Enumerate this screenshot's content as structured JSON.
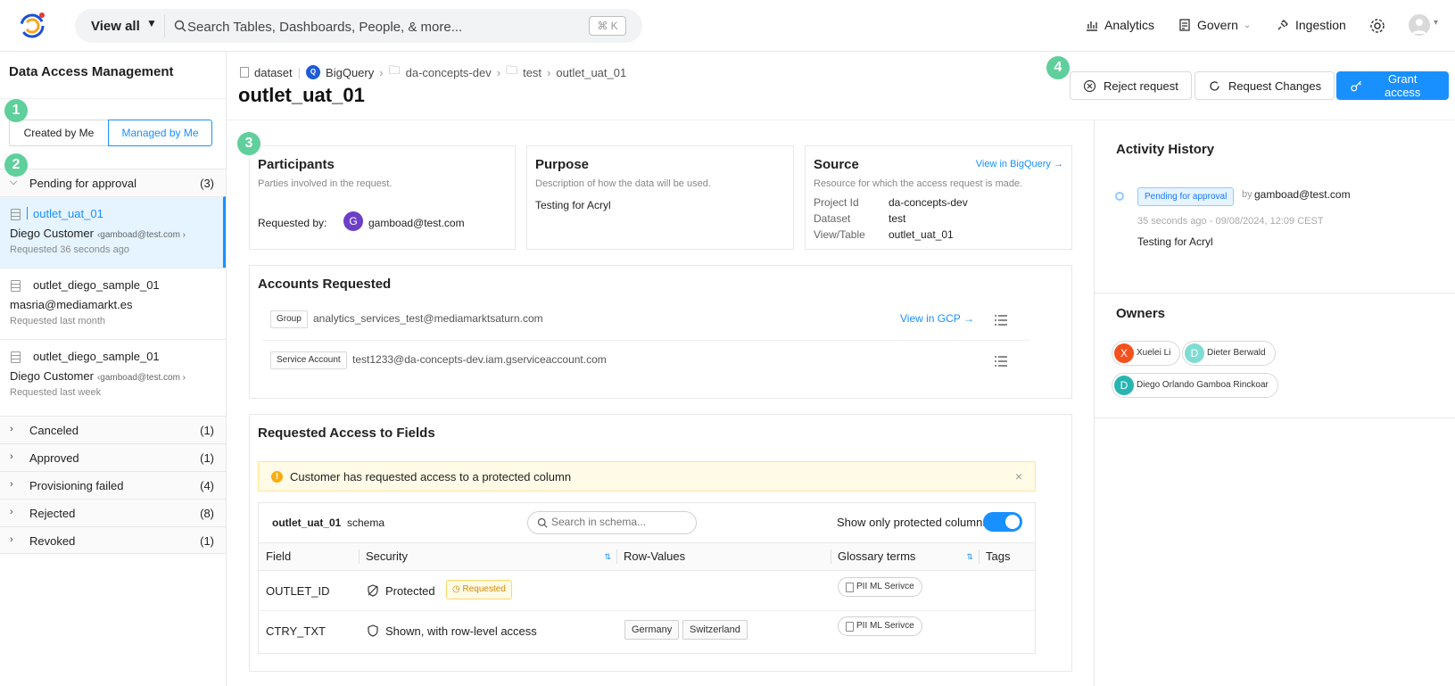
{
  "topbar": {
    "view_all": "View all",
    "search_placeholder": "Search Tables, Dashboards, People, & more...",
    "shortcut": "⌘ K",
    "nav": {
      "analytics": "Analytics",
      "govern": "Govern",
      "ingestion": "Ingestion"
    }
  },
  "sidebar": {
    "title": "Data Access Management",
    "tabs": [
      "Created by Me",
      "Managed by Me"
    ],
    "active_tab": "Managed by Me",
    "pending": {
      "label": "Pending for approval",
      "count": "(3)"
    },
    "requests": [
      {
        "name": "outlet_uat_01",
        "who": "Diego Customer",
        "email": "‹gamboad@test.com ›",
        "when": "Requested 36 seconds ago",
        "selected": true
      },
      {
        "name": "outlet_diego_sample_01",
        "who": "masria@mediamarkt.es",
        "email": "",
        "when": "Requested last month",
        "selected": false
      },
      {
        "name": "outlet_diego_sample_01",
        "who": "Diego Customer",
        "email": "‹gamboad@test.com ›",
        "when": "Requested last week",
        "selected": false
      }
    ],
    "sections": [
      {
        "label": "Canceled",
        "count": "(1)"
      },
      {
        "label": "Approved",
        "count": "(1)"
      },
      {
        "label": "Provisioning failed",
        "count": "(4)"
      },
      {
        "label": "Rejected",
        "count": "(8)"
      },
      {
        "label": "Revoked",
        "count": "(1)"
      }
    ]
  },
  "badges": [
    "1",
    "2",
    "3",
    "4"
  ],
  "header": {
    "breadcrumb": {
      "type": "dataset",
      "platform": "BigQuery",
      "project": "da-concepts-dev",
      "dataset": "test",
      "table": "outlet_uat_01"
    },
    "title": "outlet_uat_01",
    "actions": {
      "reject": "Reject request",
      "changes": "Request Changes",
      "grant": "Grant access"
    }
  },
  "participants": {
    "title": "Participants",
    "subtitle": "Parties involved in the request.",
    "requested_by_label": "Requested by:",
    "avatar_letter": "G",
    "requester": "gamboad@test.com"
  },
  "purpose": {
    "title": "Purpose",
    "subtitle": "Description of how the data will be used.",
    "text": "Testing for Acryl"
  },
  "source": {
    "title": "Source",
    "link": "View in BigQuery",
    "subtitle": "Resource for which the access request is made.",
    "project_label": "Project Id",
    "project": "da-concepts-dev",
    "dataset_label": "Dataset",
    "dataset": "test",
    "table_label": "View/Table",
    "table": "outlet_uat_01"
  },
  "accounts": {
    "title": "Accounts Requested",
    "rows": [
      {
        "type": "Group",
        "account": "analytics_services_test@mediamarktsaturn.com",
        "link": "View in GCP"
      },
      {
        "type": "Service Account",
        "account": "test1233@da-concepts-dev.iam.gserviceaccount.com",
        "link": ""
      }
    ]
  },
  "fields": {
    "title": "Requested Access to Fields",
    "alert": "Customer has requested access to a protected column",
    "schema_name": "outlet_uat_01",
    "schema_label": "schema",
    "search_placeholder": "Search in schema...",
    "toggle_label": "Show only protected columns",
    "toggle_on": true,
    "columns": [
      "Field",
      "Security",
      "Row-Values",
      "Glossary terms",
      "Tags"
    ],
    "rows": [
      {
        "field": "OUTLET_ID",
        "security": "Protected",
        "status": "Requested",
        "row_values": [],
        "glossary": "PII ML Serivce"
      },
      {
        "field": "CTRY_TXT",
        "security": "Shown, with row-level access",
        "status": "",
        "row_values": [
          "Germany",
          "Switzerland"
        ],
        "glossary": "PII ML Serivce"
      }
    ]
  },
  "activity": {
    "title": "Activity History",
    "status": "Pending for approval",
    "by": "by",
    "user": "gamboad@test.com",
    "time": "35 seconds ago - 09/08/2024, 12:09 CEST",
    "note": "Testing for Acryl"
  },
  "owners": {
    "title": "Owners",
    "list": [
      {
        "letter": "X",
        "name": "Xuelei Li",
        "color": "#f4511e"
      },
      {
        "letter": "D",
        "name": "Dieter Berwald",
        "color": "#7fdcd3"
      },
      {
        "letter": "D",
        "name": "Diego Orlando Gamboa Rinckoar",
        "color": "#26b5b0"
      }
    ]
  },
  "colors": {
    "accent": "#1890ff",
    "badge": "#5fcf9b",
    "warning": "#faad14"
  }
}
